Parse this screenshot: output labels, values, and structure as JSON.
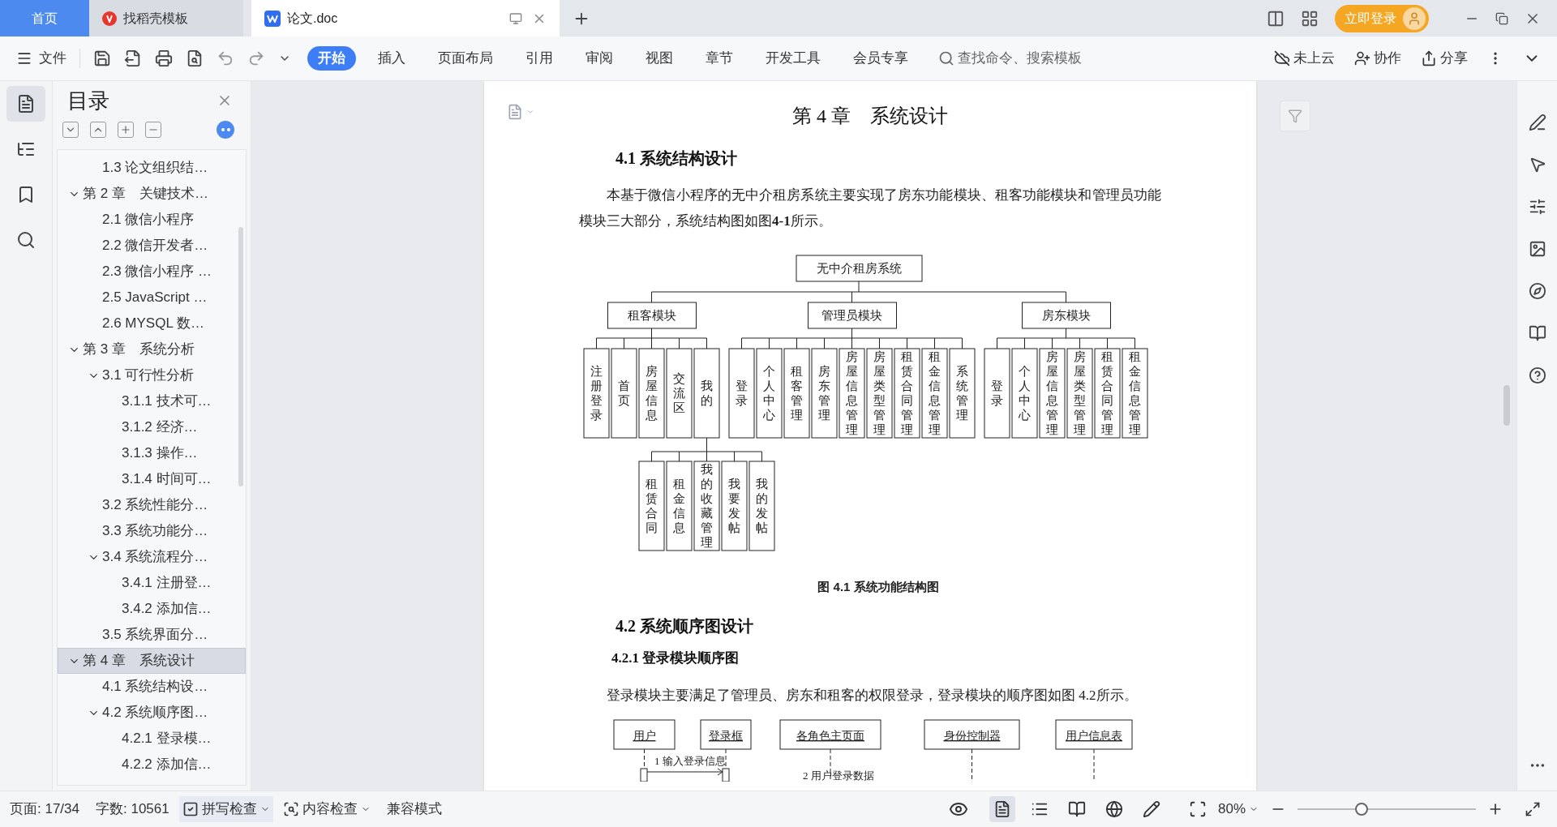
{
  "top_tabs": [
    {
      "label": "首页",
      "kind": "home",
      "selected": false
    },
    {
      "label": "找稻壳模板",
      "kind": "docer",
      "selected": false
    },
    {
      "label": "论文.doc",
      "kind": "document",
      "selected": true
    }
  ],
  "login_button": "立即登录",
  "file_menu": "文件",
  "ribbon_tabs": [
    {
      "label": "开始",
      "selected": true
    },
    {
      "label": "插入",
      "selected": false
    },
    {
      "label": "页面布局",
      "selected": false
    },
    {
      "label": "引用",
      "selected": false
    },
    {
      "label": "审阅",
      "selected": false
    },
    {
      "label": "视图",
      "selected": false
    },
    {
      "label": "章节",
      "selected": false
    },
    {
      "label": "开发工具",
      "selected": false
    },
    {
      "label": "会员专享",
      "selected": false
    }
  ],
  "command_search": {
    "placeholder": "查找命令、搜索模板"
  },
  "cloud_status": "未上云",
  "collaborate": "协作",
  "share": "分享",
  "rail_items": [
    {
      "kind": "toc",
      "selected": true
    },
    {
      "kind": "navigation",
      "selected": false
    },
    {
      "kind": "bookmark",
      "selected": false
    },
    {
      "kind": "search",
      "selected": false
    }
  ],
  "sidebar": {
    "title": "目录",
    "toc": [
      {
        "children": [
          {
            "label": "1.3 论文组织结…",
            "selected": false
          }
        ]
      },
      {
        "label": "第 2 章　关键技术…",
        "expanded": true,
        "selected": false,
        "children": [
          {
            "label": "2.1  微信小程序",
            "selected": false
          },
          {
            "label": "2.2  微信开发者…",
            "selected": false
          },
          {
            "label": "2.3 微信小程序 …",
            "selected": false
          },
          {
            "label": "2.5 JavaScript …",
            "selected": false
          },
          {
            "label": "2.6 MYSQL 数…",
            "selected": false
          }
        ]
      },
      {
        "label": "第 3 章　系统分析",
        "expanded": true,
        "selected": false,
        "children": [
          {
            "label": "3.1  可行性分析",
            "expanded": true,
            "selected": false,
            "children": [
              {
                "label": "3.1.1 技术可…",
                "selected": false
              },
              {
                "label": "3.1.2  经济…",
                "selected": false
              },
              {
                "label": "3.1.3  操作…",
                "selected": false
              },
              {
                "label": "3.1.4 时间可…",
                "selected": false
              }
            ]
          },
          {
            "label": "3.2  系统性能分…",
            "selected": false
          },
          {
            "label": "3.3  系统功能分…",
            "selected": false
          },
          {
            "label": "3.4  系统流程分…",
            "expanded": true,
            "selected": false,
            "children": [
              {
                "label": "3.4.1 注册登…",
                "selected": false
              },
              {
                "label": "3.4.2 添加信…",
                "selected": false
              }
            ]
          },
          {
            "label": "3.5 系统界面分…",
            "selected": false
          }
        ]
      },
      {
        "label": "第 4 章　系统设计",
        "expanded": true,
        "selected": true,
        "children": [
          {
            "label": "4.1 系统结构设…",
            "selected": false
          },
          {
            "label": "4.2 系统顺序图…",
            "expanded": true,
            "selected": false,
            "children": [
              {
                "label": "4.2.1 登录模…",
                "selected": false
              },
              {
                "label": "4.2.2 添加信…",
                "selected": false
              }
            ]
          }
        ]
      }
    ]
  },
  "document": {
    "blocks": [
      {
        "kind": "heading1",
        "text": "第 4 章　系统设计"
      },
      {
        "kind": "heading2",
        "text": "4.1 系统结构设计"
      },
      {
        "kind": "paragraph",
        "text": "本基于微信小程序的无中介租房系统主要实现了房东功能模块、租客功能模块和管理员功能模块三大部分，系统结构图如图**4-1**所示。"
      },
      {
        "kind": "tree_diagram",
        "root": {
          "label": "无中介租房系统",
          "children": [
            {
              "label": "租客模块",
              "children": [
                {
                  "label": "注册登录"
                },
                {
                  "label": "首页"
                },
                {
                  "label": "房屋信息"
                },
                {
                  "label": "交流区"
                },
                {
                  "label": "我的",
                  "children": [
                    {
                      "label": "租赁合同"
                    },
                    {
                      "label": "租金信息"
                    },
                    {
                      "label": "我的收藏管理"
                    },
                    {
                      "label": "我要发帖"
                    },
                    {
                      "label": "我的发帖"
                    }
                  ]
                }
              ]
            },
            {
              "label": "管理员模块",
              "children": [
                {
                  "label": "登录"
                },
                {
                  "label": "个人中心"
                },
                {
                  "label": "租客管理"
                },
                {
                  "label": "房东管理"
                },
                {
                  "label": "房屋信息管理"
                },
                {
                  "label": "房屋类型管理"
                },
                {
                  "label": "租赁合同管理"
                },
                {
                  "label": "租金信息管理"
                },
                {
                  "label": "系统管理"
                }
              ]
            },
            {
              "label": "房东模块",
              "children": [
                {
                  "label": "登录"
                },
                {
                  "label": "个人中心"
                },
                {
                  "label": "房屋信息管理"
                },
                {
                  "label": "房屋类型管理"
                },
                {
                  "label": "租赁合同管理"
                },
                {
                  "label": "租金信息管理"
                }
              ]
            }
          ]
        }
      },
      {
        "kind": "caption",
        "text": "图 4.1 系统功能结构图"
      },
      {
        "kind": "heading2",
        "text": "4.2 系统顺序图设计"
      },
      {
        "kind": "heading3",
        "text": "4.2.1 登录模块顺序图"
      },
      {
        "kind": "paragraph",
        "text": "登录模块主要满足了管理员、房东和租客的权限登录，登录模块的顺序图如图 4.2所示。"
      },
      {
        "kind": "sequence_diagram",
        "participants": [
          "用户",
          "登录框",
          "各角色主页面",
          "身份控制器",
          "用户信息表"
        ],
        "messages": [
          "1  输入登录信息",
          "2  用户登录数据"
        ]
      }
    ]
  },
  "status_bar": {
    "page": "页面: 17/34",
    "words": "字数: 10561",
    "spell_check": "拼写检查",
    "content_check": "内容检查",
    "compat_mode": "兼容模式",
    "zoom": "80%",
    "zoom_slider": {
      "level": 0.36
    },
    "view_modes": [
      {
        "kind": "page",
        "selected": true
      },
      {
        "kind": "outline",
        "selected": false
      },
      {
        "kind": "reading",
        "selected": false
      },
      {
        "kind": "web",
        "selected": false
      },
      {
        "kind": "annotate",
        "selected": false
      }
    ]
  }
}
